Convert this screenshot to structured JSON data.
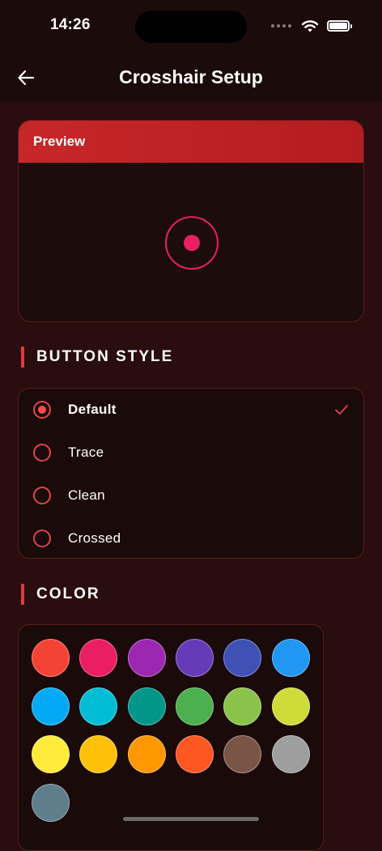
{
  "status_bar": {
    "time": "14:26",
    "icons": [
      "signal-dots",
      "wifi-icon",
      "battery-icon"
    ]
  },
  "header": {
    "title": "Crosshair Setup",
    "back_icon": "arrow-left-icon"
  },
  "preview": {
    "title": "Preview",
    "crosshair_color": "#e91e63"
  },
  "button_style": {
    "heading": "BUTTON STYLE",
    "selected_index": 0,
    "options": [
      {
        "label": "Default",
        "selected": true
      },
      {
        "label": "Trace",
        "selected": false
      },
      {
        "label": "Clean",
        "selected": false
      },
      {
        "label": "Crossed",
        "selected": false
      }
    ]
  },
  "color": {
    "heading": "COLOR",
    "swatches": [
      "#f44336",
      "#e91e63",
      "#9c27b0",
      "#673ab7",
      "#3f51b5",
      "#2196f3",
      "#03a9f4",
      "#00bcd4",
      "#009688",
      "#4caf50",
      "#8bc34a",
      "#cddc39",
      "#ffeb3b",
      "#ffc107",
      "#ff9800",
      "#ff5722",
      "#795548",
      "#9e9e9e",
      "#607d8b"
    ]
  },
  "theme": {
    "background": "#2a0d0e",
    "accent": "#e53935",
    "card": "#1a0a0a"
  }
}
